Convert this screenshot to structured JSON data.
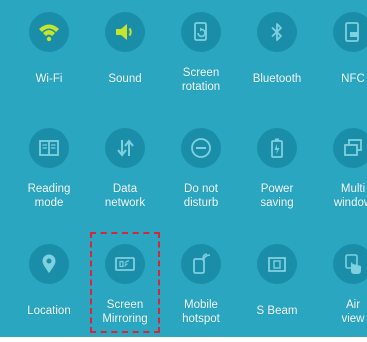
{
  "quick_settings": {
    "tiles": [
      {
        "label": "Wi-Fi",
        "icon": "wifi-icon",
        "active": true
      },
      {
        "label": "Sound",
        "icon": "sound-icon",
        "active": true
      },
      {
        "label": "Screen\nrotation",
        "icon": "screen-rotation-icon",
        "active": false
      },
      {
        "label": "Bluetooth",
        "icon": "bluetooth-icon",
        "active": false
      },
      {
        "label": "NFC",
        "icon": "nfc-icon",
        "active": false
      },
      {
        "label": "Reading\nmode",
        "icon": "book-icon",
        "active": false
      },
      {
        "label": "Data\nnetwork",
        "icon": "data-arrows-icon",
        "active": false
      },
      {
        "label": "Do not\ndisturb",
        "icon": "minus-circle-icon",
        "active": false
      },
      {
        "label": "Power\nsaving",
        "icon": "battery-icon",
        "active": false
      },
      {
        "label": "Multi\nwindow",
        "icon": "multi-window-icon",
        "active": false
      },
      {
        "label": "Location",
        "icon": "location-pin-icon",
        "active": false
      },
      {
        "label": "Screen\nMirroring",
        "icon": "screen-mirroring-icon",
        "active": false,
        "highlighted": true
      },
      {
        "label": "Mobile\nhotspot",
        "icon": "hotspot-icon",
        "active": false
      },
      {
        "label": "S Beam",
        "icon": "s-beam-icon",
        "active": false
      },
      {
        "label": "Air\nview",
        "icon": "air-view-hand-icon",
        "active": false
      }
    ]
  },
  "colors": {
    "panel_background": "#2aa6c1",
    "tile_circle": "#1a8ea8",
    "icon_inactive": "#7fd0e0",
    "icon_active": "#c8e52a",
    "label_text": "#f2fbfd",
    "highlight_border": "#d9243a"
  }
}
